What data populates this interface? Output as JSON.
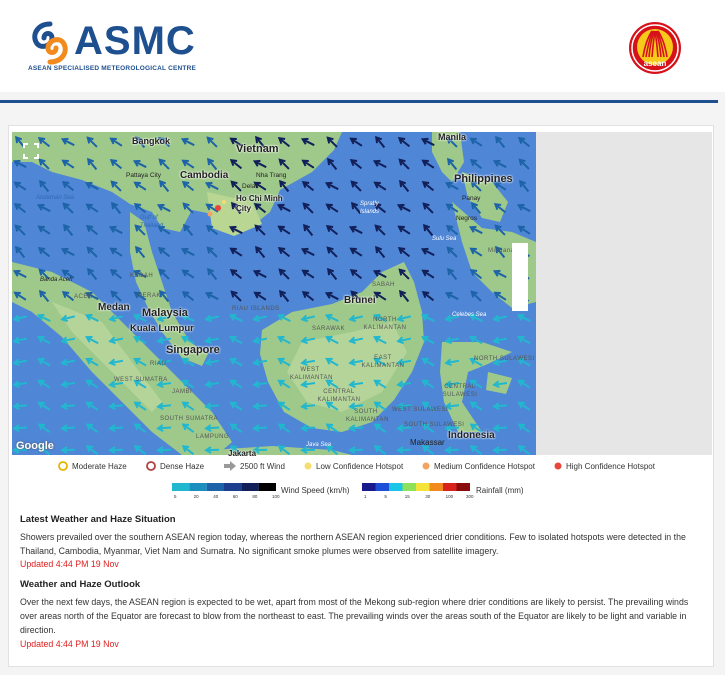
{
  "brand": {
    "name": "ASMC",
    "subtitle": "ASEAN SPECIALISED METEOROLOGICAL CENTRE",
    "partner_logo_text": "asean",
    "color": "#1e4f8f"
  },
  "map": {
    "attribution": "Google",
    "fullscreen_icon": "fullscreen-icon",
    "places": {
      "countries": [
        "Vietnam",
        "Cambodia",
        "Philippines",
        "Malaysia",
        "Singapore",
        "Brunei",
        "Indonesia"
      ],
      "cities": [
        "Bangkok",
        "Manila",
        "Pattaya City",
        "Nha Trang",
        "Delat",
        "Ho Chi Minh City",
        "Medan",
        "Kuala Lumpur",
        "Makassar",
        "Jakarta",
        "Panay",
        "Negros"
      ],
      "regions": [
        "KEDAH",
        "PERAK",
        "ACEH",
        "RIAU ISLANDS",
        "SABAH",
        "NORTH KALIMANTAN",
        "SARAWAK",
        "EAST KALIMANTAN",
        "WEST KALIMANTAN",
        "CENTRAL KALIMANTAN",
        "SOUTH KALIMANTAN",
        "RIAU",
        "WEST SUMATRA",
        "JAMBI",
        "SOUTH SUMATRA",
        "LAMPUNG",
        "NORTH SULAWESI",
        "CENTRAL SULAWESI",
        "WEST SULAWESI",
        "SOUTH SULAWESI",
        "Mindanao"
      ],
      "seas": [
        "Andaman Sea",
        "Gulf of Thailand",
        "Spratly Islands",
        "Sulu Sea",
        "Celebes Sea",
        "Java Sea",
        "Banda Aceh"
      ]
    }
  },
  "legend": {
    "items": [
      {
        "label": "Moderate Haze",
        "icon": "moderate-haze-ring-icon",
        "color": "#e8b400"
      },
      {
        "label": "Dense Haze",
        "icon": "dense-haze-ring-icon",
        "color": "#b04040"
      },
      {
        "label": "2500 ft Wind",
        "icon": "wind-arrow-icon",
        "color": "#999999"
      },
      {
        "label": "Low Confidence Hotspot",
        "icon": "low-hotspot-dot-icon",
        "color": "#f7dc6f"
      },
      {
        "label": "Medium Confidence Hotspot",
        "icon": "medium-hotspot-dot-icon",
        "color": "#f4a460"
      },
      {
        "label": "High Confidence Hotspot",
        "icon": "high-hotspot-dot-icon",
        "color": "#e8453c"
      }
    ],
    "wind_scale": {
      "label": "Wind Speed (km/h)",
      "ticks": [
        "5",
        "20",
        "40",
        "60",
        "80",
        "100"
      ],
      "colors": [
        "#21b8cf",
        "#1a8fc0",
        "#1c63a8",
        "#1c3e8c",
        "#12205a",
        "#000000"
      ]
    },
    "rain_scale": {
      "label": "Rainfall (mm)",
      "ticks": [
        "1",
        "5",
        "15",
        "30",
        "100",
        "300"
      ],
      "colors": [
        "#1a1a8c",
        "#1e4fd8",
        "#19c6e8",
        "#8fe05a",
        "#f3e43a",
        "#f28a1e",
        "#d8231a",
        "#8a0b0b"
      ]
    }
  },
  "situation": {
    "title": "Latest Weather and Haze Situation",
    "text": "Showers prevailed over the southern ASEAN region today, whereas the northern ASEAN region experienced drier conditions. Few to isolated hotspots were detected in the Thailand, Cambodia, Myanmar, Viet Nam and Sumatra. No significant smoke plumes were observed from satellite imagery.",
    "updated": "Updated 4:44 PM 19 Nov"
  },
  "outlook": {
    "title": "Weather and Haze Outlook",
    "text": "Over the next few days, the ASEAN region is expected to be wet, apart from most of the Mekong sub-region where drier conditions are likely to persist. The prevailing winds over areas north of the Equator are forecast to blow from the northeast to east. The prevailing winds over the areas south of the Equator are likely to be light and variable in direction.",
    "updated": "Updated 4:44 PM 19 Nov"
  }
}
